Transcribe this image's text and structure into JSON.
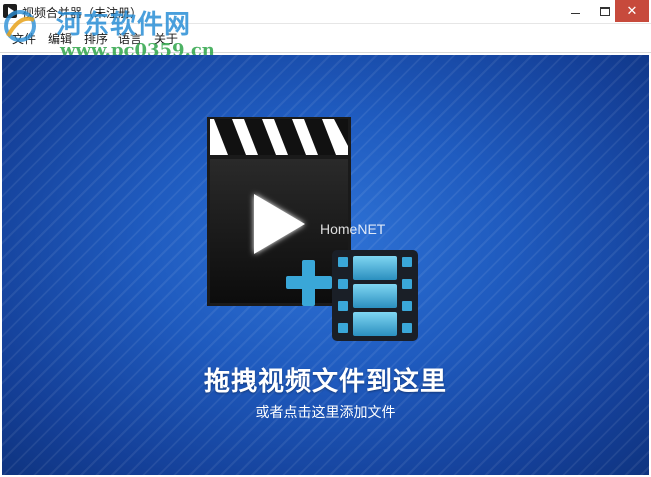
{
  "window": {
    "title": "视频合并器（未注册）",
    "controls": {
      "minimize": "minimize-icon",
      "maximize": "maximize-icon",
      "close": "close-icon"
    }
  },
  "menu": {
    "items": [
      {
        "label": "文件"
      },
      {
        "label": "编辑"
      },
      {
        "label": "排序"
      },
      {
        "label": "语言"
      },
      {
        "label": "关于"
      }
    ]
  },
  "watermark": {
    "name": "河东软件网",
    "url": "www.pc0359.cn"
  },
  "drop_zone": {
    "overlay_text": "HomeNET",
    "title": "拖拽视频文件到这里",
    "subtitle": "或者点击这里添加文件",
    "colors": {
      "background": "#1f5bbf",
      "accent": "#3aa7d8"
    },
    "icons": [
      "video-clapper-icon",
      "play-icon",
      "plus-icon",
      "film-strip-icon"
    ]
  }
}
